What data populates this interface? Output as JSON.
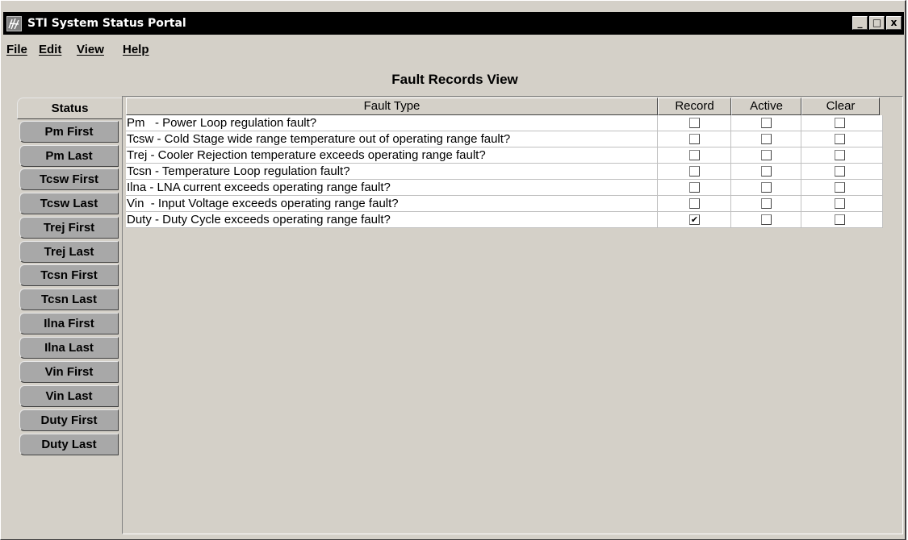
{
  "window": {
    "title": "STI System Status Portal",
    "minimize_glyph": "_",
    "maximize_glyph": "□",
    "close_glyph": "x"
  },
  "menu": [
    {
      "label": "File"
    },
    {
      "label": "Edit"
    },
    {
      "label": "View"
    },
    {
      "label": "Help"
    }
  ],
  "page_title": "Fault Records View",
  "tabs": [
    {
      "label": "Status",
      "selected": true
    },
    {
      "label": "Pm First"
    },
    {
      "label": "Pm Last"
    },
    {
      "label": "Tcsw First"
    },
    {
      "label": "Tcsw Last"
    },
    {
      "label": "Trej First"
    },
    {
      "label": "Trej Last"
    },
    {
      "label": "Tcsn First"
    },
    {
      "label": "Tcsn Last"
    },
    {
      "label": "Ilna First"
    },
    {
      "label": "Ilna Last"
    },
    {
      "label": "Vin First"
    },
    {
      "label": "Vin Last"
    },
    {
      "label": "Duty First"
    },
    {
      "label": "Duty Last"
    }
  ],
  "table": {
    "columns": [
      "Fault Type",
      "Record",
      "Active",
      "Clear"
    ],
    "rows": [
      {
        "fault": "Pm   - Power Loop regulation fault?",
        "record": false,
        "active": false,
        "clear": false
      },
      {
        "fault": "Tcsw - Cold Stage wide range temperature out of operating range fault?",
        "record": false,
        "active": false,
        "clear": false
      },
      {
        "fault": "Trej - Cooler Rejection temperature exceeds operating range fault?",
        "record": false,
        "active": false,
        "clear": false
      },
      {
        "fault": "Tcsn - Temperature Loop regulation fault?",
        "record": false,
        "active": false,
        "clear": false
      },
      {
        "fault": "Ilna - LNA current exceeds operating range fault?",
        "record": false,
        "active": false,
        "clear": false
      },
      {
        "fault": "Vin  - Input Voltage exceeds operating range fault?",
        "record": false,
        "active": false,
        "clear": false
      },
      {
        "fault": "Duty - Duty Cycle exceeds operating range fault?",
        "record": true,
        "active": false,
        "clear": false
      }
    ]
  },
  "check_glyph": "✔"
}
